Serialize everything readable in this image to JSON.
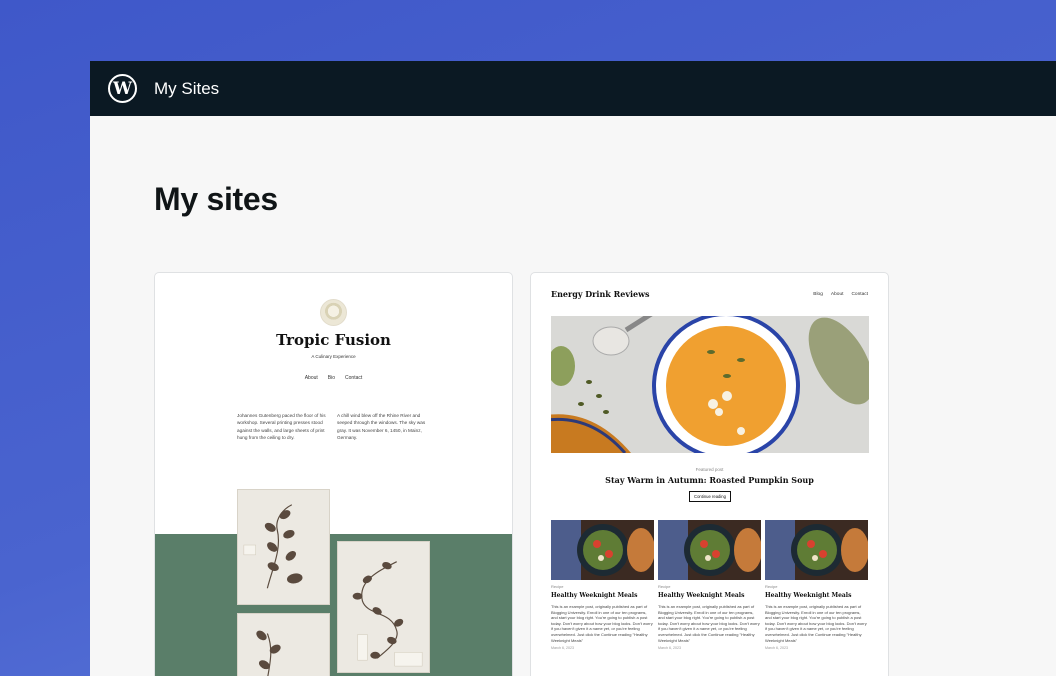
{
  "topbar": {
    "logo_glyph": "W",
    "title": "My Sites"
  },
  "page": {
    "title": "My sites"
  },
  "sites": [
    {
      "name": "Tropic Fusion",
      "tagline": "A Culinary Experience",
      "nav": [
        "About",
        "Bio",
        "Contact"
      ],
      "text_left": "Johannes Gutenberg paced the floor of his workshop. Several printing presses stood against the walls, and large sheets of print hung from the ceiling to dry.",
      "text_right": "A chill wind blew off the Rhine River and seeped through the windows. The sky was gray. It was November 6, 1450, in Mainz, Germany.",
      "accent_color": "#5a7e69"
    },
    {
      "name": "Energy Drink Reviews",
      "nav": [
        "Blog",
        "About",
        "Contact"
      ],
      "featured_label": "Featured post",
      "featured_title": "Stay Warm in Autumn: Roasted Pumpkin Soup",
      "continue_label": "Continue reading",
      "posts": [
        {
          "category": "Recipe",
          "title": "Healthy Weeknight Meals",
          "excerpt": "This is an example post, originally published as part of Blogging University. Enroll in one of our ten programs, and start your blog right. You're going to publish a post today. Don't worry about how your blog looks. Don't worry if you haven't given it a name yet, or you're feeling overwhelmed. Just click the Continue reading \"Healthy Weeknight Meals\"",
          "date": "March 6, 2023"
        },
        {
          "category": "Recipe",
          "title": "Healthy Weeknight Meals",
          "excerpt": "This is an example post, originally published as part of Blogging University. Enroll in one of our ten programs, and start your blog right. You're going to publish a post today. Don't worry about how your blog looks. Don't worry if you haven't given it a name yet, or you're feeling overwhelmed. Just click the Continue reading \"Healthy Weeknight Meals\"",
          "date": "March 6, 2023"
        },
        {
          "category": "Recipe",
          "title": "Healthy Weeknight Meals",
          "excerpt": "This is an example post, originally published as part of Blogging University. Enroll in one of our ten programs, and start your blog right. You're going to publish a post today. Don't worry about how your blog looks. Don't worry if you haven't given it a name yet, or you're feeling overwhelmed. Just click the Continue reading \"Healthy Weeknight Meals\"",
          "date": "March 6, 2023"
        }
      ]
    }
  ],
  "colors": {
    "background": "#4258c8",
    "topbar": "#0b1923",
    "page": "#f7f7f7"
  }
}
